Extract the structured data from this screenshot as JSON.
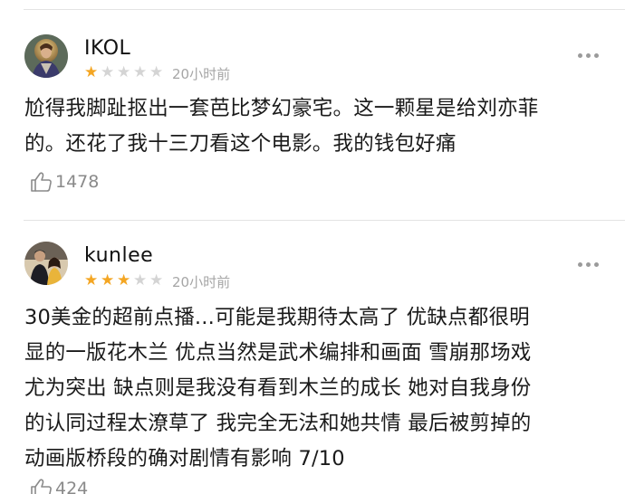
{
  "reviews": [
    {
      "username": "IKOL",
      "rating": 1,
      "max_rating": 5,
      "time": "20小时前",
      "lines": [
        "尬得我脚趾抠出一套芭比梦幻豪宅。这一颗星是给刘亦菲",
        "的。还花了我十三刀看这个电影。我的钱包好痛"
      ],
      "likes": "1478",
      "avatar_icon": "portrait-avatar-icon"
    },
    {
      "username": "kunlee",
      "rating": 3,
      "max_rating": 5,
      "time": "20小时前",
      "lines": [
        "30美金的超前点播...可能是我期待太高了 优缺点都很明",
        "显的一版花木兰 优点当然是武术编排和画面 雪崩那场戏",
        "尤为突出 缺点则是我没有看到木兰的成长 她对自我身份",
        "的认同过程太潦草了 我完全无法和她共情 最后被剪掉的",
        "动画版桥段的确对剧情有影响 7/10"
      ],
      "likes": "424",
      "avatar_icon": "photo-avatar-icon"
    }
  ],
  "icons": {
    "star": "star-icon",
    "more": "more-dots-icon",
    "like": "thumbs-up-icon"
  },
  "colors": {
    "star_filled": "#f4a623",
    "star_empty": "#d4d4d4",
    "meta_text": "#a6a6a6"
  }
}
